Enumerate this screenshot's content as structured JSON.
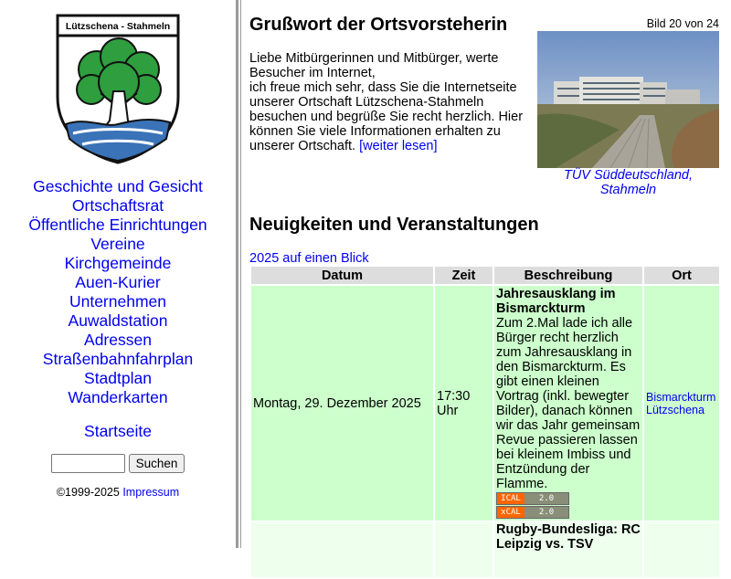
{
  "sidebar": {
    "crest": {
      "label": "Lützschena - Stahmeln",
      "colors": {
        "tree": "#2e9e3e",
        "bank": "#3a73b8",
        "outline": "#111111",
        "banner": "#ffffff"
      }
    },
    "nav": [
      "Geschichte und Gesicht",
      "Ortschaftsrat",
      "Öffentliche Einrichtungen",
      "Vereine",
      "Kirchgemeinde",
      "Auen-Kurier",
      "Unternehmen",
      "Auwaldstation",
      "Adressen",
      "Straßenbahnfahrplan",
      "Stadtplan",
      "Wanderkarten"
    ],
    "home": "Startseite",
    "search": {
      "value": "",
      "button": "Suchen"
    },
    "copyright": "©1999-2025",
    "imprint": "Impressum"
  },
  "greeting": {
    "title": "Grußwort der Ortsvorsteherin",
    "line1": "Liebe Mitbürgerinnen und Mitbürger, werte Besucher im Internet,",
    "line2": "ich freue mich sehr, dass Sie die Internetseite unserer Ortschaft Lützschena-Stahmeln besuchen und begrüße Sie recht herzlich. Hier können Sie viele Informationen erhalten zu unserer Ortschaft.",
    "more_link": "[weiter lesen]"
  },
  "photo": {
    "counter": "Bild 20 von 24",
    "caption": "TÜV Süddeutschland, Stahmeln"
  },
  "news": {
    "title": "Neuigkeiten und Veranstaltungen",
    "year_link": "2025 auf einen Blick",
    "columns": [
      "Datum",
      "Zeit",
      "Beschreibung",
      "Ort"
    ],
    "events": [
      {
        "date": "Montag, 29. Dezember 2025",
        "time": "17:30 Uhr",
        "title": "Jahresausklang im Bismarckturm",
        "text": "Zum 2.Mal lade ich alle Bürger recht herzlich zum Jahresausklang in den Bismarckturm. Es gibt einen kleinen Vortrag (inkl. bewegter Bilder), danach können wir das Jahr gemeinsam Revue passieren lassen bei kleinem Imbiss und Entzündung der Flamme.",
        "place": "Bismarckturm Lützschena",
        "badges": [
          {
            "left": "ICAL",
            "right": "2.0"
          },
          {
            "left": "xCAL",
            "right": "2.0"
          }
        ]
      },
      {
        "date": "",
        "time": "",
        "title": "Rugby-Bundesliga: RC Leipzig vs. TSV",
        "text": "",
        "place": "",
        "badges": []
      }
    ]
  }
}
